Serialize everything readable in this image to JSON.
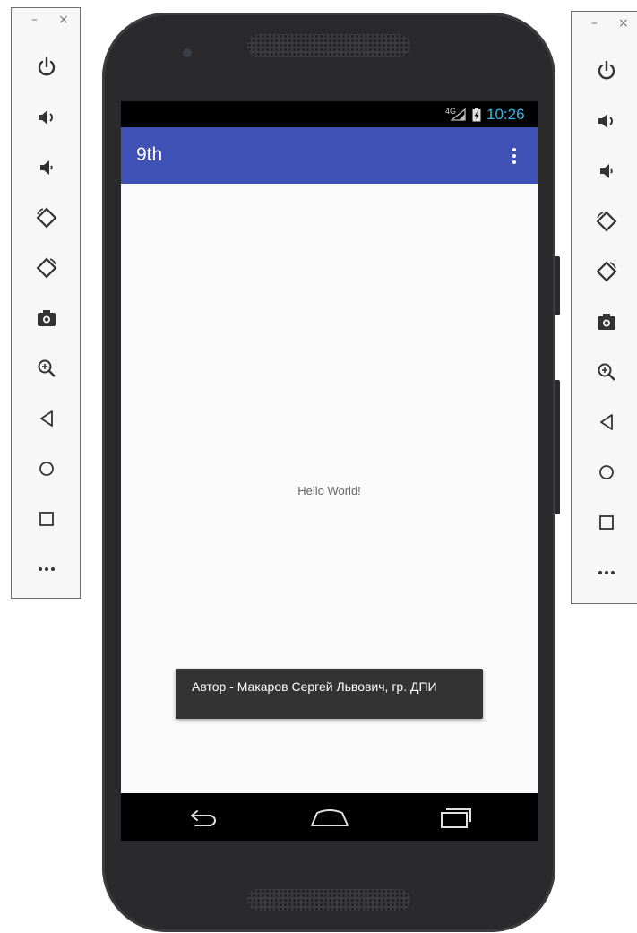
{
  "toolbar": {
    "minimize_glyph": "–",
    "close_glyph": "×",
    "buttons": [
      {
        "name": "power-icon"
      },
      {
        "name": "volume-up-icon"
      },
      {
        "name": "volume-down-icon"
      },
      {
        "name": "rotate-left-icon"
      },
      {
        "name": "rotate-right-icon"
      },
      {
        "name": "camera-icon"
      },
      {
        "name": "zoom-icon"
      },
      {
        "name": "back-icon"
      },
      {
        "name": "home-icon"
      },
      {
        "name": "overview-icon"
      },
      {
        "name": "more-icon"
      }
    ]
  },
  "status_bar": {
    "network": "4G",
    "time": "10:26",
    "time_color": "#33b5e5"
  },
  "app": {
    "title": "9th",
    "bar_color": "#3f51b5",
    "overflow_icon": "more-vert-icon",
    "hello": "Hello World!"
  },
  "toast": {
    "text": "Автор - Макаров Сергей Львович, гр. ДПИ"
  },
  "nav": {
    "back_icon": "back-arrow-icon",
    "home_icon": "home-icon",
    "recents_icon": "recents-icon"
  }
}
